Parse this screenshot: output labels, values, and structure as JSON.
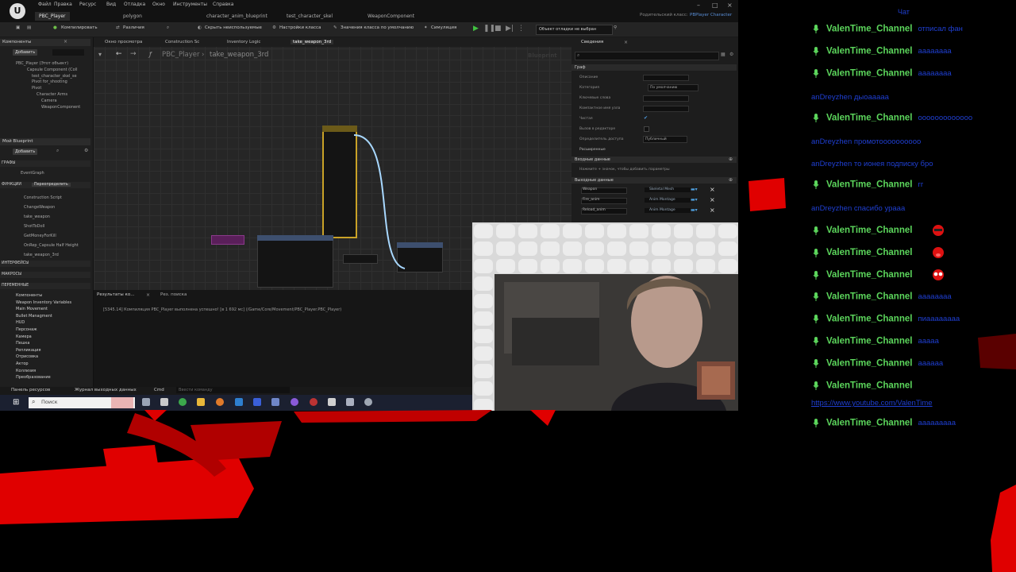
{
  "editor": {
    "menu": [
      "Файл",
      "Правка",
      "Ресурс",
      "Вид",
      "Отладка",
      "Окно",
      "Инструменты",
      "Справка"
    ],
    "tabs": [
      "PBC_Player",
      "polygon",
      "character_anim_blueprint",
      "test_character_skel",
      "WeaponComponent"
    ],
    "parent_class_label": "Родительский класс:",
    "parent_class_value": "PBPlayer Character",
    "toolbar": {
      "compile": "Компилировать",
      "diff": "Различия",
      "hide_unused": "Скрыть неиспользуемые",
      "class_settings": "Настройки класса",
      "class_defaults": "Значения класса по умолчанию",
      "simulation": "Симуляция",
      "debug_object": "Объект отладки не выбран"
    },
    "left": {
      "components_header": "Компоненты",
      "add_label": "Добавить",
      "components": [
        "PBC_Player (Этот объект)",
        "Capsule Component (Coll",
        "test_character_skel_se",
        "Pivot for_shooting",
        "Pivot",
        "Character Arms",
        "Camera",
        "WeaponComponent"
      ],
      "my_blueprint_header": "Мой Blueprint",
      "graphs_label": "ГРАФЫ",
      "event_graph": "EventGraph",
      "functions_label": "ФУНКЦИИ",
      "override_label": "Переопределить",
      "functions": [
        "Construction Script",
        "ChangeWeapon",
        "take_weapon",
        "ShotToDoll",
        "GetMoneyForKill",
        "OnRep_Capsule Half Height",
        "take_weapon_3rd"
      ],
      "interfaces_label": "ИНТЕРФЕЙСЫ",
      "macros_label": "МАКРОСЫ",
      "variables_label": "ПЕРЕМЕННЫЕ",
      "variables": [
        "Компоненты",
        "Weapon Inventory Variables",
        "Main Movement",
        "Bullet Managment",
        "HUD",
        "Персонаж",
        "Камера",
        "Пешка",
        "Репликация",
        "Отрисовка",
        "Актор",
        "Коллизия",
        "Преобразование"
      ]
    },
    "graph": {
      "tabs": [
        "Окно просмотра",
        "Construction Sc",
        "Inventory Logic",
        "take_weapon_3rd"
      ],
      "breadcrumb_root": "PBC_Player",
      "breadcrumb_current": "take_weapon_3rd",
      "watermark": "Blueprint"
    },
    "results": {
      "tabs": [
        "Результаты ко...",
        "Рез. поиска"
      ],
      "log_line": "[5345.14] Компиляция PBC_Player выполнена успешно! [в 1 692 мс] (/Game/Core/Movement/PBC_Player.PBC_Player)"
    },
    "details": {
      "header": "Сведения",
      "graph_section": "Граф",
      "rows": [
        "Описание",
        "Категория",
        "Ключевые слова",
        "Компактное имя узла",
        "Чистая",
        "Вызов в редакторе",
        "Определитель доступа"
      ],
      "category_value": "По умолчанию",
      "access_value": "Публичный",
      "advanced": "Расширенные",
      "inputs_section": "Входные данные",
      "inputs_hint": "Нажмите + значок, чтобы добавить параметры",
      "outputs_section": "Выходные данные",
      "outputs": [
        {
          "name": "Weapon",
          "type": "Skeletal Mesh"
        },
        {
          "name": "Fire_anim",
          "type": "Anim Montage"
        },
        {
          "name": "Reload_anim",
          "type": "Anim Montage"
        }
      ]
    },
    "bottom": {
      "content_browser": "Панель ресурсов",
      "output_log": "Журнал выходных данных",
      "cmd": "Cmd",
      "cmd_placeholder": "Ввести команду"
    },
    "taskbar": {
      "search_placeholder": "Поиск"
    }
  },
  "chat": {
    "header": "Чат",
    "lines": [
      {
        "name": "ValenTime_Channel",
        "msg": "отписал фан"
      },
      {
        "name": "ValenTime_Channel",
        "msg": "аааааааа"
      },
      {
        "name": "ValenTime_Channel",
        "msg": "аааааааа"
      },
      {
        "plain": "anDreyzhen дыоааааа"
      },
      {
        "name": "ValenTime_Channel",
        "msg": "ооооооооооооо"
      },
      {
        "plain": "anDreyzhen промотоооооооооо"
      },
      {
        "plain": "anDreyzhen то ионея подписку бро"
      },
      {
        "name": "ValenTime_Channel",
        "msg": "гг"
      },
      {
        "plain": "anDreyzhen спасибо  урааа"
      },
      {
        "name": "ValenTime_Channel",
        "msg": "",
        "emote": "red-face"
      },
      {
        "name": "ValenTime_Channel",
        "msg": "",
        "emote": "red-tongue"
      },
      {
        "name": "ValenTime_Channel",
        "msg": "",
        "emote": "red-glasses"
      },
      {
        "name": "ValenTime_Channel",
        "msg": "аааааааа"
      },
      {
        "name": "ValenTime_Channel",
        "msg": "пиаааааааа"
      },
      {
        "name": "ValenTime_Channel",
        "msg": "ааааа"
      },
      {
        "name": "ValenTime_Channel",
        "msg": "аааааа"
      },
      {
        "name": "ValenTime_Channel",
        "msg": ""
      },
      {
        "plain": "https://www.youtube.com/ValenTime"
      },
      {
        "name": "ValenTime_Channel",
        "msg": "ааааааааа"
      }
    ]
  },
  "colors": {
    "chat_name": "#5cd65c",
    "chat_msg": "#1f3fd2",
    "overlay_red": "#e00000"
  }
}
